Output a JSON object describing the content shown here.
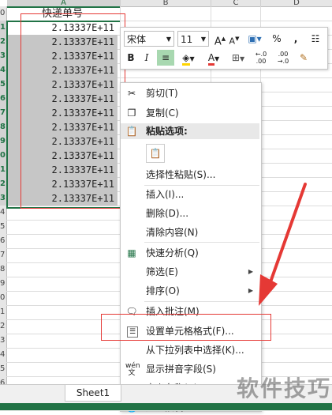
{
  "columns": [
    "A",
    "B",
    "C",
    "D"
  ],
  "rows": [
    "0",
    "1",
    "2",
    "3",
    "4",
    "5",
    "6",
    "7",
    "8",
    "9",
    "0",
    "1",
    "2",
    "3",
    "4",
    "5",
    "6",
    "7",
    "8",
    "9",
    "0",
    "1",
    "2",
    "3",
    "4",
    "5",
    "6"
  ],
  "sheet": {
    "title_cell": "快递单号",
    "values": [
      "2.13337E+11",
      "2.13337E+11",
      "2.13337E+11",
      "2.13337E+11",
      "2.13337E+11",
      "2.13337E+11",
      "2.13337E+11",
      "2.13337E+11",
      "2.13337E+11",
      "2.13337E+11",
      "2.13337E+11",
      "2.13337E+11",
      "2.13337E+11"
    ],
    "tab": "Sheet1"
  },
  "toolbar": {
    "font_name": "宋体",
    "font_size": "11",
    "bold": "B",
    "italic": "I",
    "percent": "%",
    "comma": ",",
    "increase_font": "A",
    "decrease_font": "A",
    "font_color_letter": "A",
    "increase_decimal": "←.0 .00",
    "decrease_decimal": ".00 →.0"
  },
  "menu": {
    "cut": "剪切(T)",
    "copy": "复制(C)",
    "paste_options": "粘贴选项:",
    "paste_special": "选择性粘贴(S)...",
    "insert": "插入(I)...",
    "delete": "删除(D)...",
    "clear": "清除内容(N)",
    "quick_analysis": "快速分析(Q)",
    "filter": "筛选(E)",
    "sort": "排序(O)",
    "insert_comment": "插入批注(M)",
    "format_cells": "设置单元格格式(F)...",
    "pick_from_list": "从下拉列表中选择(K)...",
    "show_phonetic": "显示拼音字段(S)",
    "define_name": "定义名称(A)...",
    "hyperlink": "超链接(I)..."
  },
  "watermark": "软件技巧",
  "colors": {
    "accent": "#217346",
    "highlight": "#e53935",
    "font_color": "#e53935",
    "fill_color": "#ffd400"
  }
}
